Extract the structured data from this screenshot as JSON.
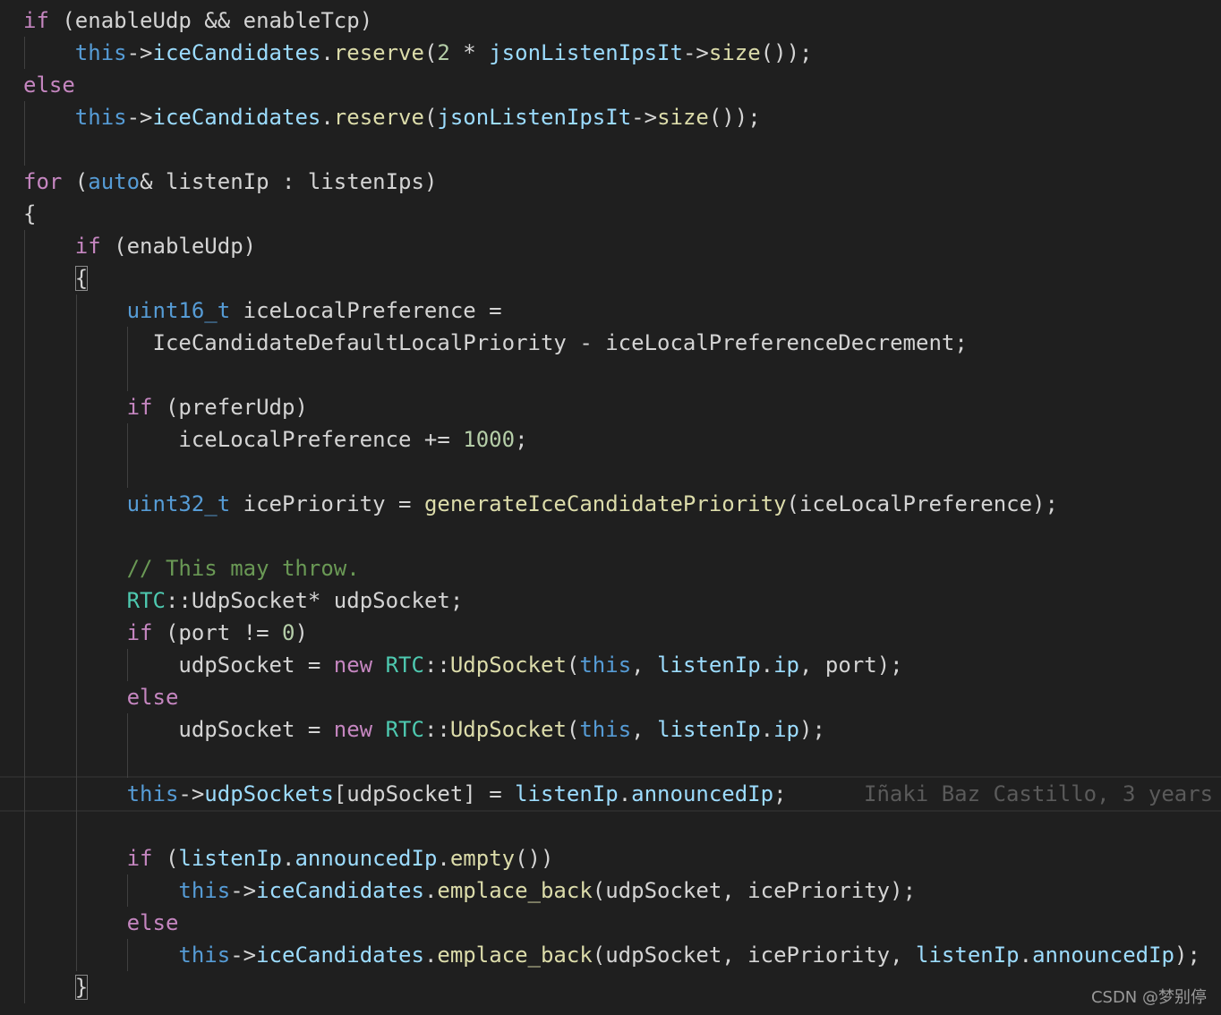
{
  "colors": {
    "keyword": "#c586c0",
    "storage": "#569cd6",
    "variable": "#9cdcfe",
    "function": "#dcdcaa",
    "type": "#4ec9b0",
    "number": "#b5cea8",
    "comment": "#6a9955",
    "text": "#d4d4d4",
    "background": "#1f1f1f"
  },
  "lines": [
    [
      {
        "c": "k",
        "s": "if"
      },
      {
        "c": "x",
        "s": " (enableUdp && enableTcp)"
      }
    ],
    [
      {
        "c": "x",
        "s": "    "
      },
      {
        "c": "s",
        "s": "this"
      },
      {
        "c": "x",
        "s": "->"
      },
      {
        "c": "v",
        "s": "iceCandidates"
      },
      {
        "c": "x",
        "s": "."
      },
      {
        "c": "f",
        "s": "reserve"
      },
      {
        "c": "x",
        "s": "("
      },
      {
        "c": "n",
        "s": "2"
      },
      {
        "c": "x",
        "s": " * "
      },
      {
        "c": "v",
        "s": "jsonListenIpsIt"
      },
      {
        "c": "x",
        "s": "->"
      },
      {
        "c": "f",
        "s": "size"
      },
      {
        "c": "x",
        "s": "());"
      }
    ],
    [
      {
        "c": "k",
        "s": "else"
      }
    ],
    [
      {
        "c": "x",
        "s": "    "
      },
      {
        "c": "s",
        "s": "this"
      },
      {
        "c": "x",
        "s": "->"
      },
      {
        "c": "v",
        "s": "iceCandidates"
      },
      {
        "c": "x",
        "s": "."
      },
      {
        "c": "f",
        "s": "reserve"
      },
      {
        "c": "x",
        "s": "("
      },
      {
        "c": "v",
        "s": "jsonListenIpsIt"
      },
      {
        "c": "x",
        "s": "->"
      },
      {
        "c": "f",
        "s": "size"
      },
      {
        "c": "x",
        "s": "());"
      }
    ],
    [],
    [
      {
        "c": "k",
        "s": "for"
      },
      {
        "c": "x",
        "s": " ("
      },
      {
        "c": "s",
        "s": "auto"
      },
      {
        "c": "x",
        "s": "& listenIp : listenIps)"
      }
    ],
    [
      {
        "c": "x",
        "s": "{"
      }
    ],
    [
      {
        "c": "x",
        "s": "    "
      },
      {
        "c": "k",
        "s": "if"
      },
      {
        "c": "x",
        "s": " (enableUdp)"
      }
    ],
    [
      {
        "c": "x",
        "s": "    "
      },
      {
        "c": "x",
        "s": "{",
        "box": true
      }
    ],
    [
      {
        "c": "x",
        "s": "        "
      },
      {
        "c": "s",
        "s": "uint16_t"
      },
      {
        "c": "x",
        "s": " iceLocalPreference ="
      }
    ],
    [
      {
        "c": "x",
        "s": "          IceCandidateDefaultLocalPriority - iceLocalPreferenceDecrement;"
      }
    ],
    [],
    [
      {
        "c": "x",
        "s": "        "
      },
      {
        "c": "k",
        "s": "if"
      },
      {
        "c": "x",
        "s": " (preferUdp)"
      }
    ],
    [
      {
        "c": "x",
        "s": "            iceLocalPreference += "
      },
      {
        "c": "n",
        "s": "1000"
      },
      {
        "c": "x",
        "s": ";"
      }
    ],
    [],
    [
      {
        "c": "x",
        "s": "        "
      },
      {
        "c": "s",
        "s": "uint32_t"
      },
      {
        "c": "x",
        "s": " icePriority = "
      },
      {
        "c": "f",
        "s": "generateIceCandidatePriority"
      },
      {
        "c": "x",
        "s": "(iceLocalPreference);"
      }
    ],
    [],
    [
      {
        "c": "x",
        "s": "        "
      },
      {
        "c": "m",
        "s": "// This may throw."
      }
    ],
    [
      {
        "c": "x",
        "s": "        "
      },
      {
        "c": "t",
        "s": "RTC"
      },
      {
        "c": "x",
        "s": "::UdpSocket* udpSocket;"
      }
    ],
    [
      {
        "c": "x",
        "s": "        "
      },
      {
        "c": "k",
        "s": "if"
      },
      {
        "c": "x",
        "s": " (port != "
      },
      {
        "c": "n",
        "s": "0"
      },
      {
        "c": "x",
        "s": ")"
      }
    ],
    [
      {
        "c": "x",
        "s": "            udpSocket = "
      },
      {
        "c": "k",
        "s": "new"
      },
      {
        "c": "x",
        "s": " "
      },
      {
        "c": "t",
        "s": "RTC"
      },
      {
        "c": "x",
        "s": "::"
      },
      {
        "c": "f",
        "s": "UdpSocket"
      },
      {
        "c": "x",
        "s": "("
      },
      {
        "c": "s",
        "s": "this"
      },
      {
        "c": "x",
        "s": ", "
      },
      {
        "c": "v",
        "s": "listenIp"
      },
      {
        "c": "x",
        "s": "."
      },
      {
        "c": "v",
        "s": "ip"
      },
      {
        "c": "x",
        "s": ", port);"
      }
    ],
    [
      {
        "c": "x",
        "s": "        "
      },
      {
        "c": "k",
        "s": "else"
      }
    ],
    [
      {
        "c": "x",
        "s": "            udpSocket = "
      },
      {
        "c": "k",
        "s": "new"
      },
      {
        "c": "x",
        "s": " "
      },
      {
        "c": "t",
        "s": "RTC"
      },
      {
        "c": "x",
        "s": "::"
      },
      {
        "c": "f",
        "s": "UdpSocket"
      },
      {
        "c": "x",
        "s": "("
      },
      {
        "c": "s",
        "s": "this"
      },
      {
        "c": "x",
        "s": ", "
      },
      {
        "c": "v",
        "s": "listenIp"
      },
      {
        "c": "x",
        "s": "."
      },
      {
        "c": "v",
        "s": "ip"
      },
      {
        "c": "x",
        "s": ");"
      }
    ],
    [],
    [
      {
        "c": "x",
        "s": "        "
      },
      {
        "c": "s",
        "s": "this"
      },
      {
        "c": "x",
        "s": "->"
      },
      {
        "c": "v",
        "s": "udpSockets"
      },
      {
        "c": "x",
        "s": "[udpSocket] = "
      },
      {
        "c": "v",
        "s": "listenIp"
      },
      {
        "c": "x",
        "s": "."
      },
      {
        "c": "v",
        "s": "announcedIp"
      },
      {
        "c": "x",
        "s": ";"
      }
    ],
    [],
    [
      {
        "c": "x",
        "s": "        "
      },
      {
        "c": "k",
        "s": "if"
      },
      {
        "c": "x",
        "s": " ("
      },
      {
        "c": "v",
        "s": "listenIp"
      },
      {
        "c": "x",
        "s": "."
      },
      {
        "c": "v",
        "s": "announcedIp"
      },
      {
        "c": "x",
        "s": "."
      },
      {
        "c": "f",
        "s": "empty"
      },
      {
        "c": "x",
        "s": "())"
      }
    ],
    [
      {
        "c": "x",
        "s": "            "
      },
      {
        "c": "s",
        "s": "this"
      },
      {
        "c": "x",
        "s": "->"
      },
      {
        "c": "v",
        "s": "iceCandidates"
      },
      {
        "c": "x",
        "s": "."
      },
      {
        "c": "f",
        "s": "emplace_back"
      },
      {
        "c": "x",
        "s": "(udpSocket, icePriority);"
      }
    ],
    [
      {
        "c": "x",
        "s": "        "
      },
      {
        "c": "k",
        "s": "else"
      }
    ],
    [
      {
        "c": "x",
        "s": "            "
      },
      {
        "c": "s",
        "s": "this"
      },
      {
        "c": "x",
        "s": "->"
      },
      {
        "c": "v",
        "s": "iceCandidates"
      },
      {
        "c": "x",
        "s": "."
      },
      {
        "c": "f",
        "s": "emplace_back"
      },
      {
        "c": "x",
        "s": "(udpSocket, icePriority, "
      },
      {
        "c": "v",
        "s": "listenIp"
      },
      {
        "c": "x",
        "s": "."
      },
      {
        "c": "v",
        "s": "announcedIp"
      },
      {
        "c": "x",
        "s": ");"
      }
    ],
    [
      {
        "c": "x",
        "s": "    "
      },
      {
        "c": "x",
        "s": "}",
        "box": true
      }
    ]
  ],
  "current_line": 24,
  "blame": "Iñaki Baz Castillo, 3 years",
  "watermark": "CSDN @梦别停"
}
